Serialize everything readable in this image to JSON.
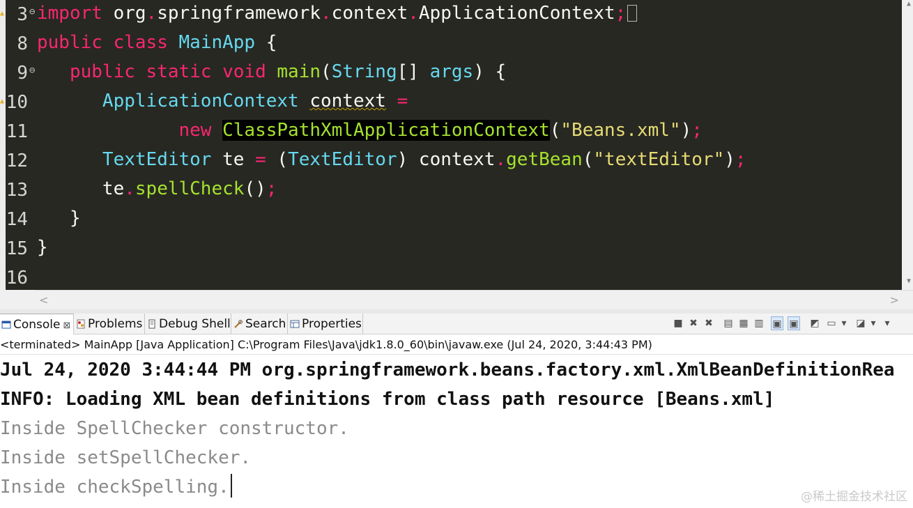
{
  "editor": {
    "line_numbers": [
      "3",
      "8",
      "9",
      "10",
      "11",
      "12",
      "13",
      "14",
      "15",
      "16"
    ],
    "lines": [
      [
        {
          "t": "import",
          "c": "kw"
        },
        {
          "t": " org",
          "c": "id"
        },
        {
          "t": ".",
          "c": "op"
        },
        {
          "t": "springframework",
          "c": "id"
        },
        {
          "t": ".",
          "c": "op"
        },
        {
          "t": "context",
          "c": "id"
        },
        {
          "t": ".",
          "c": "op"
        },
        {
          "t": "ApplicationContext",
          "c": "id"
        },
        {
          "t": ";",
          "c": "op"
        }
      ],
      [
        {
          "t": "public",
          "c": "kw"
        },
        {
          "t": " ",
          "c": "id"
        },
        {
          "t": "class",
          "c": "kw"
        },
        {
          "t": " ",
          "c": "id"
        },
        {
          "t": "MainApp",
          "c": "ty"
        },
        {
          "t": " {",
          "c": "id"
        }
      ],
      [
        {
          "t": "   ",
          "c": "id"
        },
        {
          "t": "public",
          "c": "kw"
        },
        {
          "t": " ",
          "c": "id"
        },
        {
          "t": "static",
          "c": "kw"
        },
        {
          "t": " ",
          "c": "id"
        },
        {
          "t": "void",
          "c": "kw"
        },
        {
          "t": " ",
          "c": "id"
        },
        {
          "t": "main",
          "c": "fn"
        },
        {
          "t": "(",
          "c": "id"
        },
        {
          "t": "String",
          "c": "ty"
        },
        {
          "t": "[] ",
          "c": "id"
        },
        {
          "t": "args",
          "c": "ty"
        },
        {
          "t": ") {",
          "c": "id"
        }
      ],
      [
        {
          "t": "      ",
          "c": "id"
        },
        {
          "t": "ApplicationContext",
          "c": "ty"
        },
        {
          "t": " ",
          "c": "id"
        },
        {
          "t": "context",
          "c": "id squig"
        },
        {
          "t": " ",
          "c": "id"
        },
        {
          "t": "=",
          "c": "op"
        }
      ],
      [
        {
          "t": "             ",
          "c": "id"
        },
        {
          "t": "new",
          "c": "kw"
        },
        {
          "t": " ",
          "c": "id"
        },
        {
          "t": "ClassPathXmlApplicationContext",
          "c": "fn hl"
        },
        {
          "t": "(",
          "c": "id"
        },
        {
          "t": "\"Beans.xml\"",
          "c": "st"
        },
        {
          "t": ")",
          "c": "id"
        },
        {
          "t": ";",
          "c": "op"
        }
      ],
      [
        {
          "t": "      ",
          "c": "id"
        },
        {
          "t": "TextEditor",
          "c": "ty"
        },
        {
          "t": " te ",
          "c": "id"
        },
        {
          "t": "=",
          "c": "op"
        },
        {
          "t": " (",
          "c": "id"
        },
        {
          "t": "TextEditor",
          "c": "ty"
        },
        {
          "t": ") context",
          "c": "id"
        },
        {
          "t": ".",
          "c": "op"
        },
        {
          "t": "getBean",
          "c": "fn"
        },
        {
          "t": "(",
          "c": "id"
        },
        {
          "t": "\"textEditor\"",
          "c": "st"
        },
        {
          "t": ")",
          "c": "id"
        },
        {
          "t": ";",
          "c": "op"
        }
      ],
      [
        {
          "t": "      te",
          "c": "id"
        },
        {
          "t": ".",
          "c": "op"
        },
        {
          "t": "spellCheck",
          "c": "fn"
        },
        {
          "t": "()",
          "c": "id"
        },
        {
          "t": ";",
          "c": "op"
        }
      ],
      [
        {
          "t": "   }",
          "c": "id"
        }
      ],
      [
        {
          "t": "}",
          "c": "id"
        }
      ],
      []
    ],
    "fold_markers": [
      "3",
      "9"
    ],
    "warning_lines": [
      "3",
      "10"
    ]
  },
  "console_view": {
    "tabs": [
      {
        "label": "Console",
        "icon": "console-icon",
        "active": true
      },
      {
        "label": "Problems",
        "icon": "problems-icon",
        "active": false
      },
      {
        "label": "Debug Shell",
        "icon": "debug-shell-icon",
        "active": false
      },
      {
        "label": "Search",
        "icon": "search-icon",
        "active": false
      },
      {
        "label": "Properties",
        "icon": "properties-icon",
        "active": false
      }
    ],
    "close_glyph": "⊠",
    "status": "<terminated> MainApp [Java Application] C:\\Program Files\\Java\\jdk1.8.0_60\\bin\\javaw.exe (Jul 24, 2020, 3:44:43 PM)",
    "output": [
      {
        "text": "Jul 24, 2020 3:44:44 PM org.springframework.beans.factory.xml.XmlBeanDefinitionRea",
        "stream": "err"
      },
      {
        "text": "INFO: Loading XML bean definitions from class path resource [Beans.xml]",
        "stream": "err"
      },
      {
        "text": "Inside SpellChecker constructor.",
        "stream": "std"
      },
      {
        "text": "Inside setSpellChecker.",
        "stream": "std"
      },
      {
        "text": "Inside checkSpelling.",
        "stream": "std"
      }
    ],
    "watermark": "@稀土掘金技术社区"
  },
  "colors": {
    "editor_bg": "#272822",
    "keyword": "#f92672",
    "type": "#66d9ef",
    "function": "#a6e22e",
    "string": "#e6db74"
  }
}
